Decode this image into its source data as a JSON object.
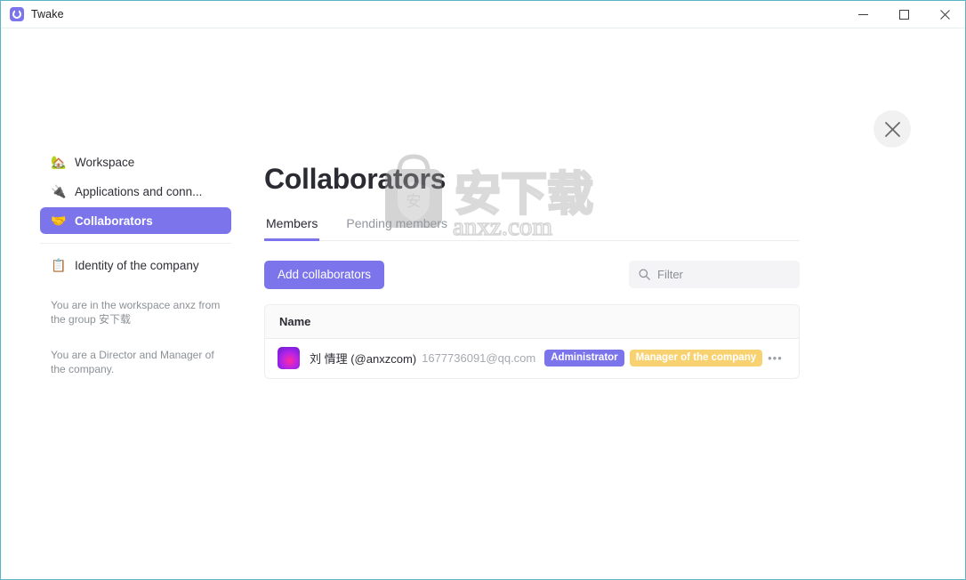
{
  "titlebar": {
    "app_name": "Twake",
    "app_icon": "twake-logo-icon",
    "minimize_label": "–",
    "maximize_label": "□",
    "close_label": "✕"
  },
  "modal": {
    "close_icon": "close-icon"
  },
  "sidebar": {
    "items": [
      {
        "emoji": "🏡",
        "icon": "house-with-garden-icon",
        "label": "Workspace",
        "active": false
      },
      {
        "emoji": "🔌",
        "icon": "electric-plug-icon",
        "label": "Applications and conn...",
        "active": false
      },
      {
        "emoji": "🤝",
        "icon": "handshake-icon",
        "label": "Collaborators",
        "active": true
      },
      {
        "emoji": "📋",
        "icon": "clipboard-icon",
        "label": "Identity of the company",
        "active": false
      }
    ],
    "notes": [
      "You are in the workspace anxz from the group 安下载",
      "You are a Director and Manager of the company."
    ]
  },
  "main": {
    "page_title": "Collaborators",
    "tabs": [
      {
        "label": "Members",
        "active": true
      },
      {
        "label": "Pending members",
        "active": false
      }
    ],
    "add_button_label": "Add collaborators",
    "filter": {
      "icon": "search-icon",
      "placeholder": "Filter",
      "value": ""
    },
    "table": {
      "columns": [
        "Name"
      ],
      "rows": [
        {
          "avatar": "user-avatar",
          "name": "刘 情理 (@anxzcom)",
          "email": "1677736091@qq.com",
          "badges": [
            {
              "label": "Administrator",
              "color": "#7b74ea"
            },
            {
              "label": "Manager of the company",
              "color": "#f8d271"
            }
          ],
          "menu_label": "•••"
        }
      ]
    }
  },
  "watermark": {
    "text": "anxz.com",
    "logo_text": "安下载",
    "shield_text": "安"
  },
  "colors": {
    "accent": "#7b74ea",
    "badge_manager": "#f8d271",
    "window_border": "#5ab4c6",
    "text_primary": "#2b2b33",
    "text_muted": "#8c9196"
  }
}
